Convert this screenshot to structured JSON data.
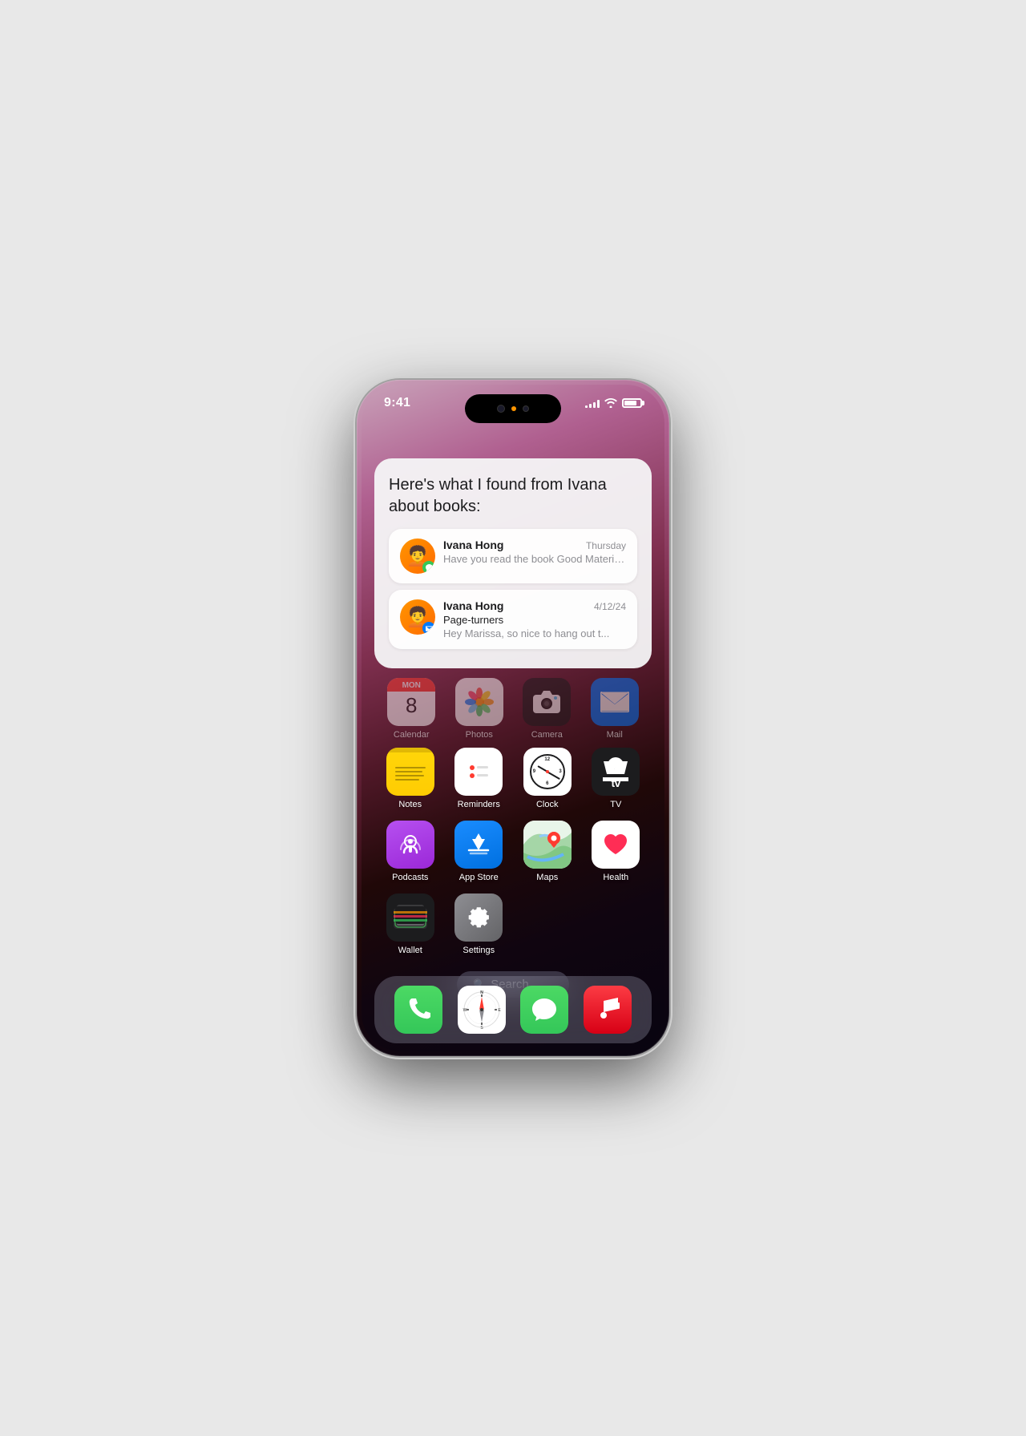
{
  "phone": {
    "status": {
      "time": "9:41",
      "signal": [
        3,
        5,
        7,
        9,
        11
      ],
      "battery_pct": 80
    },
    "siri_card": {
      "question": "Here's what I found from Ivana about books:",
      "results": [
        {
          "sender": "Ivana Hong",
          "date": "Thursday",
          "preview": "Have you read the book Good Material yet? Just read it with my b...",
          "app": "messages"
        },
        {
          "sender": "Ivana Hong",
          "date": "4/12/24",
          "subject": "Page-turners",
          "preview": "Hey Marissa, so nice to hang out t...",
          "app": "mail"
        }
      ]
    },
    "top_row": {
      "apps": [
        {
          "label": "Calendar",
          "icon": "calendar"
        },
        {
          "label": "Photos",
          "icon": "photos"
        },
        {
          "label": "Camera",
          "icon": "camera"
        },
        {
          "label": "Mail",
          "icon": "mail"
        }
      ]
    },
    "home_grid": [
      [
        {
          "label": "Notes",
          "icon": "notes"
        },
        {
          "label": "Reminders",
          "icon": "reminders"
        },
        {
          "label": "Clock",
          "icon": "clock"
        },
        {
          "label": "TV",
          "icon": "appletv"
        }
      ],
      [
        {
          "label": "Podcasts",
          "icon": "podcasts"
        },
        {
          "label": "App Store",
          "icon": "appstore"
        },
        {
          "label": "Maps",
          "icon": "maps"
        },
        {
          "label": "Health",
          "icon": "health"
        }
      ],
      [
        {
          "label": "Wallet",
          "icon": "wallet"
        },
        {
          "label": "Settings",
          "icon": "settings"
        },
        {
          "label": "",
          "icon": "empty"
        },
        {
          "label": "",
          "icon": "empty"
        }
      ]
    ],
    "search": {
      "placeholder": "Search"
    },
    "dock": [
      {
        "label": "Phone",
        "icon": "phone"
      },
      {
        "label": "Safari",
        "icon": "safari"
      },
      {
        "label": "Messages",
        "icon": "messages"
      },
      {
        "label": "Music",
        "icon": "music"
      }
    ]
  }
}
